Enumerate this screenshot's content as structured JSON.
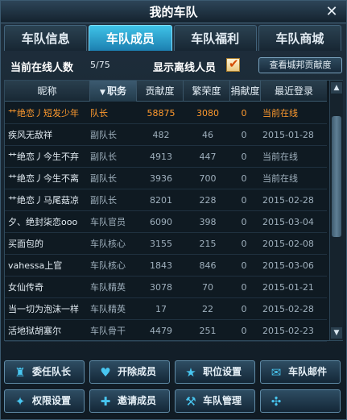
{
  "window": {
    "title": "我的车队",
    "close_symbol": "✕"
  },
  "tabs": [
    {
      "label": "车队信息",
      "active": false
    },
    {
      "label": "车队成员",
      "active": true
    },
    {
      "label": "车队福利",
      "active": false
    },
    {
      "label": "车队商城",
      "active": false
    }
  ],
  "infobar": {
    "online_label": "当前在线人数",
    "online_count": "5/75",
    "offline_label": "显示离线人员",
    "offline_checked": true,
    "check_mark": "✔",
    "view_button": "查看城邦贡献度"
  },
  "table": {
    "headers": [
      "昵称",
      "职务",
      "贡献度",
      "繁荣度",
      "捐献度",
      "最近登录"
    ],
    "sort_icon": "▼",
    "rows": [
      {
        "name": "艹绝恋丿短发少年",
        "role": "队长",
        "contribution": "58875",
        "prosperity": "3080",
        "donation": "0",
        "last_login": "当前在线",
        "highlight": true
      },
      {
        "name": "疾风无敌祥",
        "role": "副队长",
        "contribution": "482",
        "prosperity": "46",
        "donation": "0",
        "last_login": "2015-01-28",
        "highlight": false
      },
      {
        "name": "艹绝恋丿今生不弃",
        "role": "副队长",
        "contribution": "4913",
        "prosperity": "447",
        "donation": "0",
        "last_login": "当前在线",
        "highlight": false
      },
      {
        "name": "艹绝恋丿今生不离",
        "role": "副队长",
        "contribution": "3936",
        "prosperity": "700",
        "donation": "0",
        "last_login": "当前在线",
        "highlight": false
      },
      {
        "name": "艹绝恋丿马尾菇凉",
        "role": "副队长",
        "contribution": "8201",
        "prosperity": "228",
        "donation": "0",
        "last_login": "2015-02-28",
        "highlight": false
      },
      {
        "name": "夕、绝封柒恋ooo",
        "role": "车队官员",
        "contribution": "6090",
        "prosperity": "398",
        "donation": "0",
        "last_login": "2015-03-04",
        "highlight": false
      },
      {
        "name": "买面包的",
        "role": "车队核心",
        "contribution": "3155",
        "prosperity": "215",
        "donation": "0",
        "last_login": "2015-02-08",
        "highlight": false
      },
      {
        "name": "vahessa上官",
        "role": "车队核心",
        "contribution": "1843",
        "prosperity": "846",
        "donation": "0",
        "last_login": "2015-03-06",
        "highlight": false
      },
      {
        "name": "女仙传奇",
        "role": "车队精英",
        "contribution": "3078",
        "prosperity": "70",
        "donation": "0",
        "last_login": "2015-01-21",
        "highlight": false
      },
      {
        "name": "当一切为泡沫一样",
        "role": "车队精英",
        "contribution": "17",
        "prosperity": "22",
        "donation": "0",
        "last_login": "2015-02-28",
        "highlight": false
      },
      {
        "name": "活地狱胡塞尔",
        "role": "车队骨干",
        "contribution": "4479",
        "prosperity": "251",
        "donation": "0",
        "last_login": "2015-02-23",
        "highlight": false
      }
    ]
  },
  "scrollbar": {
    "up": "▲",
    "down": "▼"
  },
  "buttons": [
    {
      "label": "委任队长",
      "icon": "♜"
    },
    {
      "label": "开除成员",
      "icon": "♥"
    },
    {
      "label": "职位设置",
      "icon": "★"
    },
    {
      "label": "车队邮件",
      "icon": "✉"
    },
    {
      "label": "权限设置",
      "icon": "✦"
    },
    {
      "label": "邀请成员",
      "icon": "✚"
    },
    {
      "label": "车队管理",
      "icon": "⚒"
    },
    {
      "label": "",
      "icon": "✣"
    }
  ],
  "colors": {
    "accent": "#3fc3e8",
    "highlight_row": "#ff9a2e",
    "icon": "#48c6f0"
  }
}
